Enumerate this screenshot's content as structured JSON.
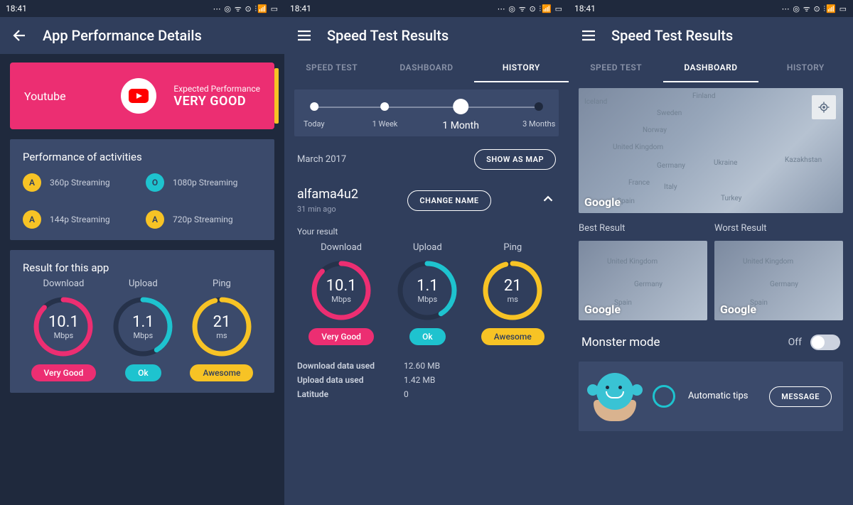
{
  "status": {
    "time": "18:41",
    "icons": "⋯  ◎ ᯤ ⊙ ⫶📶 ▭"
  },
  "screen1": {
    "title": "App Performance Details",
    "hero": {
      "name": "Youtube",
      "expected_label": "Expected Performance",
      "expected_value": "VERY GOOD"
    },
    "activities": {
      "title": "Performance of activities",
      "items": [
        {
          "badge": "A",
          "label": "360p Streaming",
          "color": "y"
        },
        {
          "badge": "O",
          "label": "1080p Streaming",
          "color": "t"
        },
        {
          "badge": "A",
          "label": "144p Streaming",
          "color": "y"
        },
        {
          "badge": "A",
          "label": "720p Streaming",
          "color": "y"
        }
      ]
    },
    "result": {
      "title": "Result for this app",
      "download": {
        "label": "Download",
        "value": "10.1",
        "unit": "Mbps",
        "pill": "Very Good"
      },
      "upload": {
        "label": "Upload",
        "value": "1.1",
        "unit": "Mbps",
        "pill": "Ok"
      },
      "ping": {
        "label": "Ping",
        "value": "21",
        "unit": "ms",
        "pill": "Awesome"
      }
    }
  },
  "screen2": {
    "title": "Speed Test Results",
    "tabs": [
      "SPEED TEST",
      "DASHBOARD",
      "HISTORY"
    ],
    "active_tab": 2,
    "timeline": {
      "stops": [
        {
          "label": "Today",
          "pos": 4
        },
        {
          "label": "1 Week",
          "pos": 33
        },
        {
          "label": "1 Month",
          "pos": 64,
          "active": true
        },
        {
          "label": "3 Months",
          "pos": 96,
          "dark": true
        }
      ]
    },
    "month": "March 2017",
    "map_btn": "SHOW AS MAP",
    "entry": {
      "name": "alfama4u2",
      "time": "31 min ago",
      "change": "CHANGE NAME",
      "subhdr": "Your result"
    },
    "result": {
      "download": {
        "label": "Download",
        "value": "10.1",
        "unit": "Mbps",
        "pill": "Very Good"
      },
      "upload": {
        "label": "Upload",
        "value": "1.1",
        "unit": "Mbps",
        "pill": "Ok"
      },
      "ping": {
        "label": "Ping",
        "value": "21",
        "unit": "ms",
        "pill": "Awesome"
      }
    },
    "details": [
      {
        "k": "Download data used",
        "v": "12.60 MB"
      },
      {
        "k": "Upload data used",
        "v": "1.42 MB"
      },
      {
        "k": "Latitude",
        "v": "0"
      }
    ]
  },
  "screen3": {
    "title": "Speed Test Results",
    "tabs": [
      "SPEED TEST",
      "DASHBOARD",
      "HISTORY"
    ],
    "active_tab": 1,
    "best_label": "Best Result",
    "worst_label": "Worst Result",
    "monster": {
      "label": "Monster mode",
      "state": "Off"
    },
    "tips": {
      "text": "Automatic tips",
      "btn": "MESSAGE"
    },
    "map_logo": "Google",
    "map_places": [
      "Iceland",
      "Finland",
      "Sweden",
      "Norway",
      "United Kingdom",
      "Germany",
      "Ukraine",
      "Kazakhstan",
      "France",
      "Italy",
      "Spain",
      "Turkey"
    ]
  }
}
